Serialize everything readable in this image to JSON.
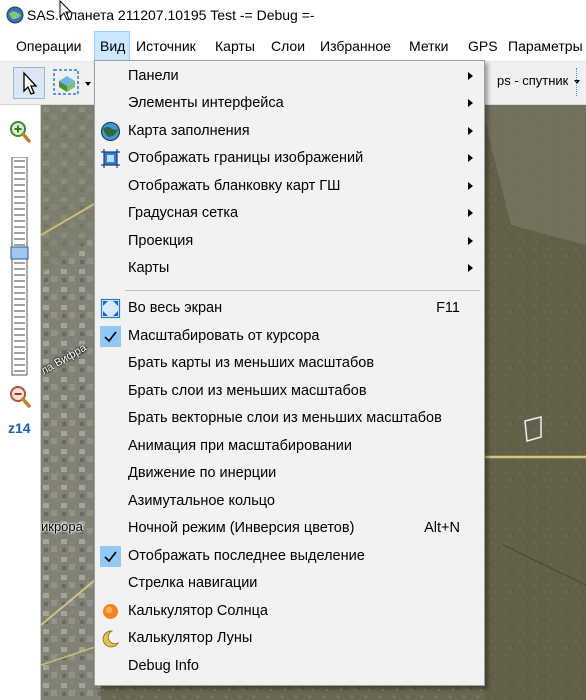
{
  "window": {
    "title": "SAS.Планета 211207.10195 Test -= Debug =-"
  },
  "menubar": {
    "items": [
      {
        "label": "Операции"
      },
      {
        "label": "Вид"
      },
      {
        "label": "Источник"
      },
      {
        "label": "Карты"
      },
      {
        "label": "Слои"
      },
      {
        "label": "Избранное"
      },
      {
        "label": "Метки"
      },
      {
        "label": "GPS"
      },
      {
        "label": "Параметры"
      }
    ],
    "active_index": 1
  },
  "toolbar": {
    "map_type_label": "ps - спутник"
  },
  "sidepanel": {
    "zoom_label": "z14",
    "zoom_level": 14
  },
  "map": {
    "labels": [
      {
        "text": "ла Вифра"
      },
      {
        "text": "икрора"
      }
    ]
  },
  "dropdown": {
    "items": [
      {
        "label": "Панели",
        "submenu": true
      },
      {
        "label": "Элементы интерфейса",
        "submenu": true
      },
      {
        "label": "Карта заполнения",
        "submenu": true,
        "icon": "globe-icon"
      },
      {
        "label": "Отображать границы изображений",
        "submenu": true,
        "icon": "image-bounds-icon"
      },
      {
        "label": "Отображать бланковку карт ГШ",
        "submenu": true
      },
      {
        "label": "Градусная сетка",
        "submenu": true
      },
      {
        "label": "Проекция",
        "submenu": true
      },
      {
        "label": "Карты",
        "submenu": true
      },
      {
        "label": "Во весь экран",
        "shortcut": "F11",
        "icon": "fullscreen-icon"
      },
      {
        "label": "Масштабировать от курсора",
        "checked": true
      },
      {
        "label": "Брать карты из меньших масштабов"
      },
      {
        "label": "Брать слои из меньших масштабов"
      },
      {
        "label": "Брать векторные слои из меньших масштабов"
      },
      {
        "label": "Анимация при масштабировании"
      },
      {
        "label": "Движение по инерции"
      },
      {
        "label": "Азимутальное кольцо"
      },
      {
        "label": "Ночной режим (Инверсия цветов)",
        "shortcut": "Alt+N"
      },
      {
        "label": "Отображать последнее выделение",
        "checked": true
      },
      {
        "label": "Стрелка навигации"
      },
      {
        "label": "Калькулятор Солнца",
        "icon": "sun-icon"
      },
      {
        "label": "Калькулятор Луны",
        "icon": "moon-icon"
      },
      {
        "label": "Debug Info"
      }
    ]
  },
  "colors": {
    "menu_highlight": "#cce8ff",
    "menu_bg": "#f2f2f2",
    "check_bg": "#90c8f6",
    "zoom_label": "#1a5fb4"
  }
}
